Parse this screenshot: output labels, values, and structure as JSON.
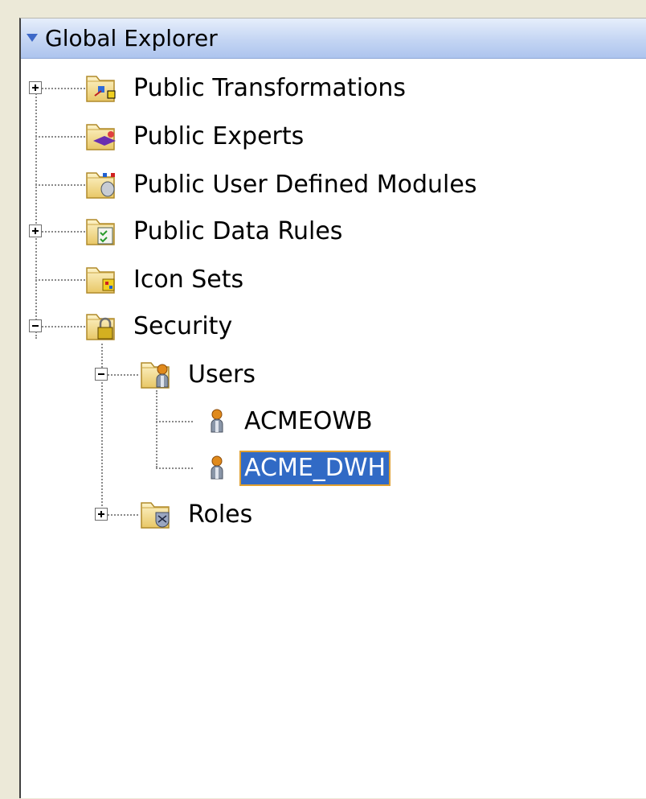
{
  "panel": {
    "title": "Global Explorer",
    "accent": "#316ac5",
    "tree": {
      "public_transformations": {
        "label": "Public Transformations",
        "icon": "transformations-folder-icon",
        "state": "collapsed"
      },
      "public_experts": {
        "label": "Public Experts",
        "icon": "experts-folder-icon"
      },
      "public_user_defined_modules": {
        "label": "Public User Defined Modules",
        "icon": "modules-folder-icon"
      },
      "public_data_rules": {
        "label": "Public Data Rules",
        "icon": "data-rules-folder-icon",
        "state": "collapsed"
      },
      "icon_sets": {
        "label": "Icon Sets",
        "icon": "icon-sets-folder-icon"
      },
      "security": {
        "label": "Security",
        "icon": "security-folder-icon",
        "state": "expanded",
        "users": {
          "label": "Users",
          "icon": "users-folder-icon",
          "state": "expanded",
          "items": [
            {
              "label": "ACMEOWB",
              "icon": "user-icon"
            },
            {
              "label": "ACME_DWH",
              "icon": "user-icon",
              "selected": true
            }
          ]
        },
        "roles": {
          "label": "Roles",
          "icon": "roles-folder-icon",
          "state": "collapsed"
        }
      }
    }
  }
}
